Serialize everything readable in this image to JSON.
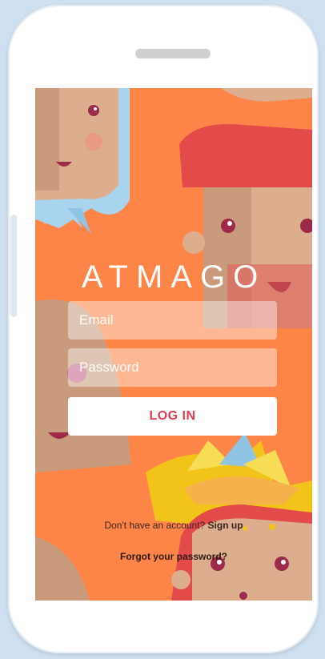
{
  "app": {
    "logo_text": "ATMAGO"
  },
  "login_form": {
    "email_placeholder": "Email",
    "password_placeholder": "Password",
    "login_label": "LOG IN"
  },
  "footer": {
    "signup_prompt": "Don't have an account?",
    "signup_link": "Sign up",
    "forgot_password": "Forgot your password?"
  },
  "colors": {
    "background": "#ff8447",
    "button_text": "#e23d4e",
    "character_red": "#e24b4a",
    "skin": "#dcae8e",
    "bandana": "#a8d4ee",
    "leaf_yellow": "#f2c318"
  }
}
